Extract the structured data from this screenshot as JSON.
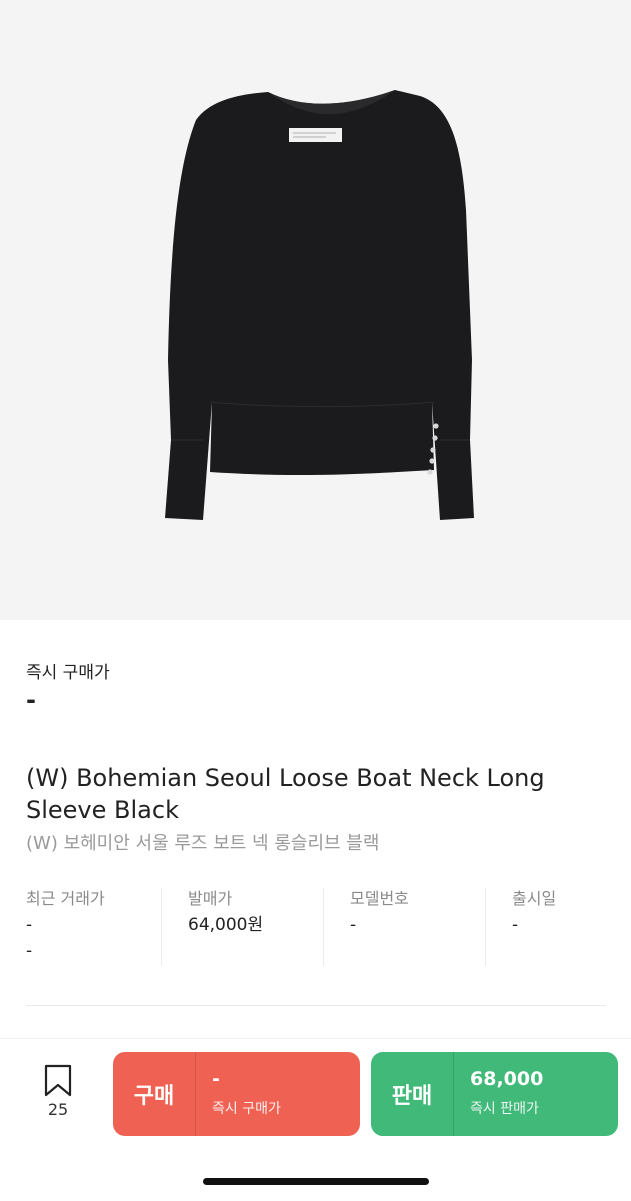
{
  "product": {
    "image_alt": "black long sleeve boat neck top",
    "instant_buy_label": "즉시 구매가",
    "instant_buy_price": "-",
    "title_en": "(W) Bohemian Seoul Loose Boat Neck Long Sleeve Black",
    "title_ko": "(W) 보헤미안 서울 루즈 보트 넥 롱슬리브 블랙"
  },
  "info": [
    {
      "label": "최근 거래가",
      "value": "-",
      "value2": "-"
    },
    {
      "label": "발매가",
      "value": "64,000원",
      "value2": ""
    },
    {
      "label": "모델번호",
      "value": "-",
      "value2": ""
    },
    {
      "label": "출시일",
      "value": "-",
      "value2": ""
    }
  ],
  "bottom": {
    "bookmark_count": "25",
    "buy": {
      "label": "구매",
      "price": "-",
      "sub": "즉시 구매가",
      "color": "#ef6253"
    },
    "sell": {
      "label": "판매",
      "price": "68,000",
      "sub": "즉시 판매가",
      "color": "#41b979"
    }
  }
}
